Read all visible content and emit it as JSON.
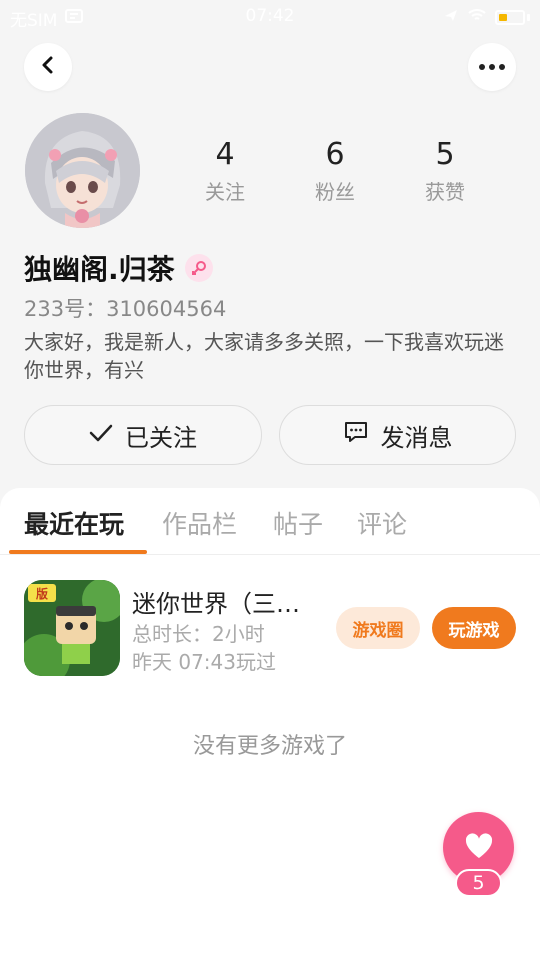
{
  "status_bar": {
    "carrier": "无SIM",
    "time": "07:42"
  },
  "profile": {
    "stats": [
      {
        "value": "4",
        "label": "关注"
      },
      {
        "value": "6",
        "label": "粉丝"
      },
      {
        "value": "5",
        "label": "获赞"
      }
    ],
    "username": "独幽阁.归茶",
    "user_id": "233号：310604564",
    "bio": "大家好，我是新人，大家请多多关照，一下我喜欢玩迷你世界，有兴"
  },
  "actions": {
    "follow_label": "已关注",
    "message_label": "发消息"
  },
  "tabs": [
    "最近在玩",
    "作品栏",
    "帖子",
    "评论"
  ],
  "active_tab": 0,
  "game": {
    "title": "迷你世界（三…",
    "duration": "总时长：2小时",
    "last_played": "昨天 07:43玩过",
    "circle_label": "游戏圈",
    "play_label": "玩游戏"
  },
  "no_more_text": "没有更多游戏了",
  "likes": {
    "count": "5"
  },
  "colors": {
    "accent": "#f07a1e",
    "like": "#f55a8a"
  }
}
